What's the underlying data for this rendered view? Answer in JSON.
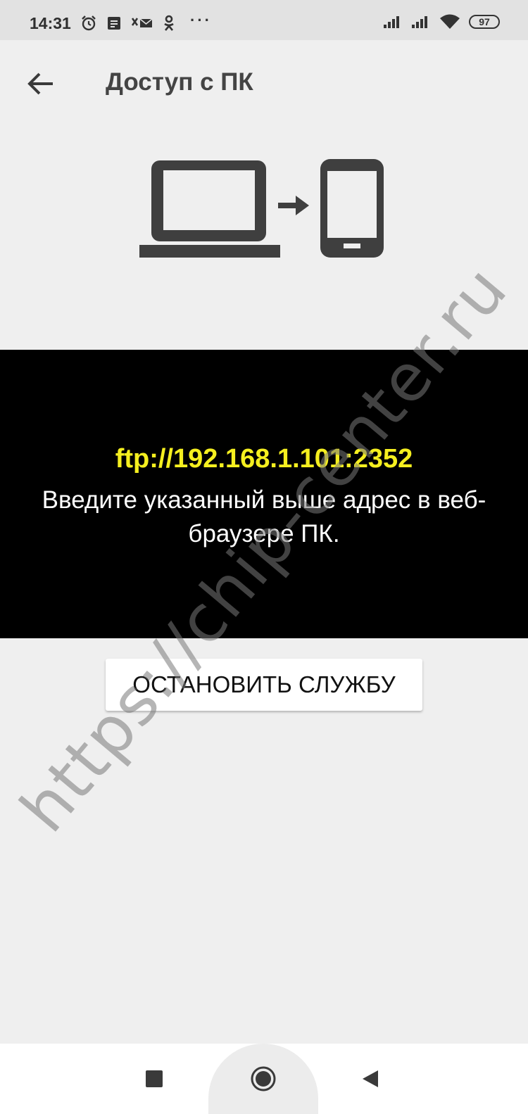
{
  "status_bar": {
    "time": "14:31",
    "left_icons": [
      "alarm-icon",
      "notification-icon",
      "message-icon",
      "odnoklassniki-icon"
    ],
    "more": "···",
    "battery": "97"
  },
  "toolbar": {
    "title": "Доступ с ПК"
  },
  "panel": {
    "ftp_address": "ftp://192.168.1.101:2352",
    "instruction": "Введите указанный выше адрес в веб-браузере ПК."
  },
  "actions": {
    "stop_label": "ОСТАНОВИТЬ СЛУЖБУ"
  },
  "watermark": "https://chip-center.ru",
  "colors": {
    "background": "#efefef",
    "panel": "#000000",
    "address": "#f5ef1f",
    "icon": "#3f3f3f"
  }
}
